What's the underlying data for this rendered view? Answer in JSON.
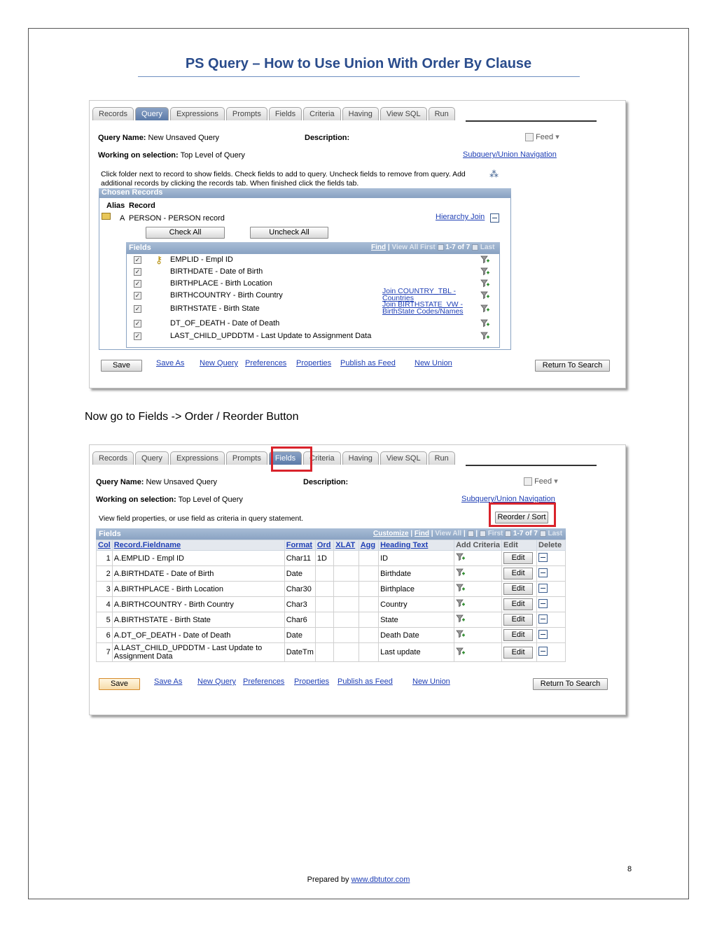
{
  "header": {
    "title": "PS Query – How to Use Union With Order By Clause"
  },
  "caption": "Now go to Fields -> Order / Reorder Button",
  "page_number": "8",
  "footer": {
    "prefix": "Prepared by",
    "link": "www.dbtutor.com"
  },
  "shot1": {
    "tabs": [
      "Records",
      "Query",
      "Expressions",
      "Prompts",
      "Fields",
      "Criteria",
      "Having",
      "View SQL",
      "Run"
    ],
    "active_tab": "Query",
    "query_name_label": "Query Name:",
    "query_name": "New Unsaved Query",
    "description_label": "Description:",
    "feed": "Feed",
    "working_label": "Working on selection:",
    "working_value": "Top Level of Query",
    "subquery_link": "Subquery/Union Navigation",
    "instructions": "Click folder next to record to show fields. Check fields to add to query. Uncheck fields to remove from query. Add additional records by clicking the records tab. When finished click the fields tab.",
    "chosen_records": "Chosen Records",
    "alias_header": "Alias",
    "record_header": "Record",
    "record_alias": "A",
    "record_name": "PERSON - PERSON record",
    "hierarchy_join": "Hierarchy Join",
    "check_all": "Check All",
    "uncheck_all": "Uncheck All",
    "fields_header": "Fields",
    "nav": {
      "find": "Find",
      "view_all": "View All",
      "first": "First",
      "range": "1-7 of 7",
      "last": "Last"
    },
    "fields": [
      {
        "name": "EMPLID - Empl ID",
        "checked": true,
        "key": true,
        "join": ""
      },
      {
        "name": "BIRTHDATE - Date of Birth",
        "checked": true,
        "key": false,
        "join": ""
      },
      {
        "name": "BIRTHPLACE - Birth Location",
        "checked": true,
        "key": false,
        "join": ""
      },
      {
        "name": "BIRTHCOUNTRY - Birth Country",
        "checked": true,
        "key": false,
        "join": "Join COUNTRY_TBL - Countries"
      },
      {
        "name": "BIRTHSTATE - Birth State",
        "checked": true,
        "key": false,
        "join": "Join BIRTHSTATE_VW - BirthState Codes/Names"
      },
      {
        "name": "DT_OF_DEATH - Date of Death",
        "checked": true,
        "key": false,
        "join": ""
      },
      {
        "name": "LAST_CHILD_UPDDTM - Last Update to Assignment Data",
        "checked": true,
        "key": false,
        "join": ""
      }
    ],
    "bottom": {
      "save": "Save",
      "links": [
        "Save As",
        "New Query",
        "Preferences",
        "Properties",
        "Publish as Feed",
        "New Union"
      ],
      "return": "Return To Search"
    }
  },
  "shot2": {
    "tabs": [
      "Records",
      "Query",
      "Expressions",
      "Prompts",
      "Fields",
      "Criteria",
      "Having",
      "View SQL",
      "Run"
    ],
    "active_tab": "Fields",
    "query_name_label": "Query Name:",
    "query_name": "New Unsaved Query",
    "description_label": "Description:",
    "feed": "Feed",
    "working_label": "Working on selection:",
    "working_value": "Top Level of Query",
    "subquery_link": "Subquery/Union Navigation",
    "instructions": "View field properties, or use field as criteria in query statement.",
    "reorder": "Reorder / Sort",
    "fields_header": "Fields",
    "nav": {
      "customize": "Customize",
      "find": "Find",
      "view_all": "View All",
      "first": "First",
      "range": "1-7 of 7",
      "last": "Last"
    },
    "columns": [
      "Col",
      "Record.Fieldname",
      "Format",
      "Ord",
      "XLAT",
      "Agg",
      "Heading Text",
      "Add Criteria",
      "Edit",
      "Delete"
    ],
    "rows": [
      {
        "col": "1",
        "field": "A.EMPLID - Empl ID",
        "format": "Char11",
        "ord": "1D",
        "xlat": "",
        "agg": "",
        "heading": "ID"
      },
      {
        "col": "2",
        "field": "A.BIRTHDATE - Date of Birth",
        "format": "Date",
        "ord": "",
        "xlat": "",
        "agg": "",
        "heading": "Birthdate"
      },
      {
        "col": "3",
        "field": "A.BIRTHPLACE - Birth Location",
        "format": "Char30",
        "ord": "",
        "xlat": "",
        "agg": "",
        "heading": "Birthplace"
      },
      {
        "col": "4",
        "field": "A.BIRTHCOUNTRY - Birth Country",
        "format": "Char3",
        "ord": "",
        "xlat": "",
        "agg": "",
        "heading": "Country"
      },
      {
        "col": "5",
        "field": "A.BIRTHSTATE - Birth State",
        "format": "Char6",
        "ord": "",
        "xlat": "",
        "agg": "",
        "heading": "State"
      },
      {
        "col": "6",
        "field": "A.DT_OF_DEATH - Date of Death",
        "format": "Date",
        "ord": "",
        "xlat": "",
        "agg": "",
        "heading": "Death Date"
      },
      {
        "col": "7",
        "field": "A.LAST_CHILD_UPDDTM - Last Update to Assignment Data",
        "format": "DateTm",
        "ord": "",
        "xlat": "",
        "agg": "",
        "heading": "Last update"
      }
    ],
    "edit_label": "Edit",
    "bottom": {
      "save": "Save",
      "links": [
        "Save As",
        "New Query",
        "Preferences",
        "Properties",
        "Publish as Feed",
        "New Union"
      ],
      "return": "Return To Search"
    }
  },
  "colors": {
    "title": "#2a4c8c",
    "link": "#1f3fb5",
    "highlight": "#d9232b",
    "panel": "#8aa3c3"
  }
}
